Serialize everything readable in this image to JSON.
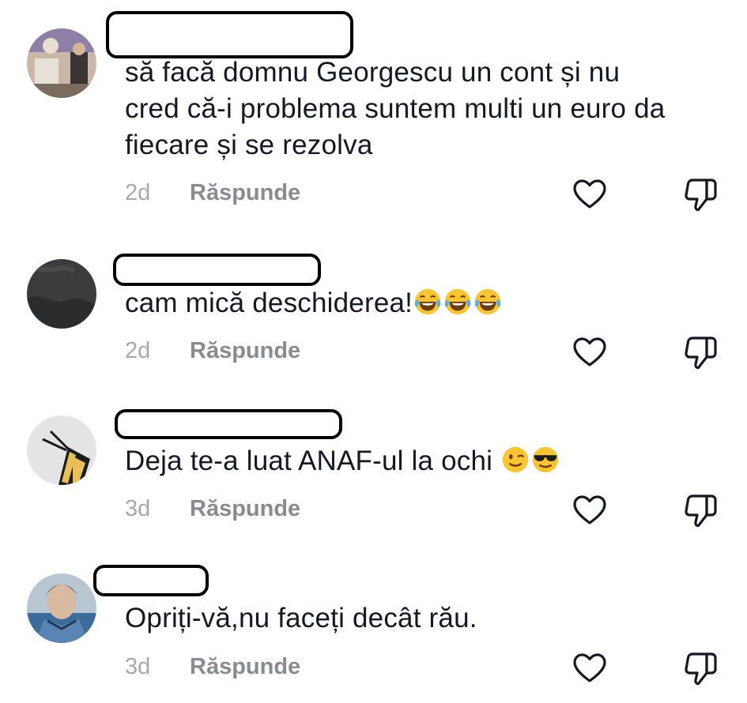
{
  "comments": [
    {
      "text": "să facă domnu Georgescu un cont și nu\ncred că-i problema suntem multi un euro da\nfiecare și se rezolva",
      "age": "2d",
      "reply_label": "Răspunde",
      "avatar": "photo-avatar-event"
    },
    {
      "text": "cam mică deschiderea!",
      "emojis": [
        "tears-of-joy",
        "tears-of-joy",
        "tears-of-joy"
      ],
      "age": "2d",
      "reply_label": "Răspunde",
      "avatar": "photo-avatar-dark"
    },
    {
      "text": "Deja te-a luat ANAF-ul la ochi ",
      "emojis": [
        "winking-face",
        "smiling-face-with-sunglasses"
      ],
      "age": "3d",
      "reply_label": "Răspunde",
      "avatar": "photo-avatar-butterfly"
    },
    {
      "text": "Opriți-vă,nu faceți decât rău.",
      "age": "3d",
      "reply_label": "Răspunde",
      "avatar": "photo-avatar-character"
    }
  ],
  "icons": {
    "like": "heart-outline-icon",
    "dislike": "thumbs-down-outline-icon"
  },
  "colors": {
    "text": "#161823",
    "secondary": "#8a8b91",
    "timestamp": "#a8a8ad",
    "icon": "#161823"
  }
}
